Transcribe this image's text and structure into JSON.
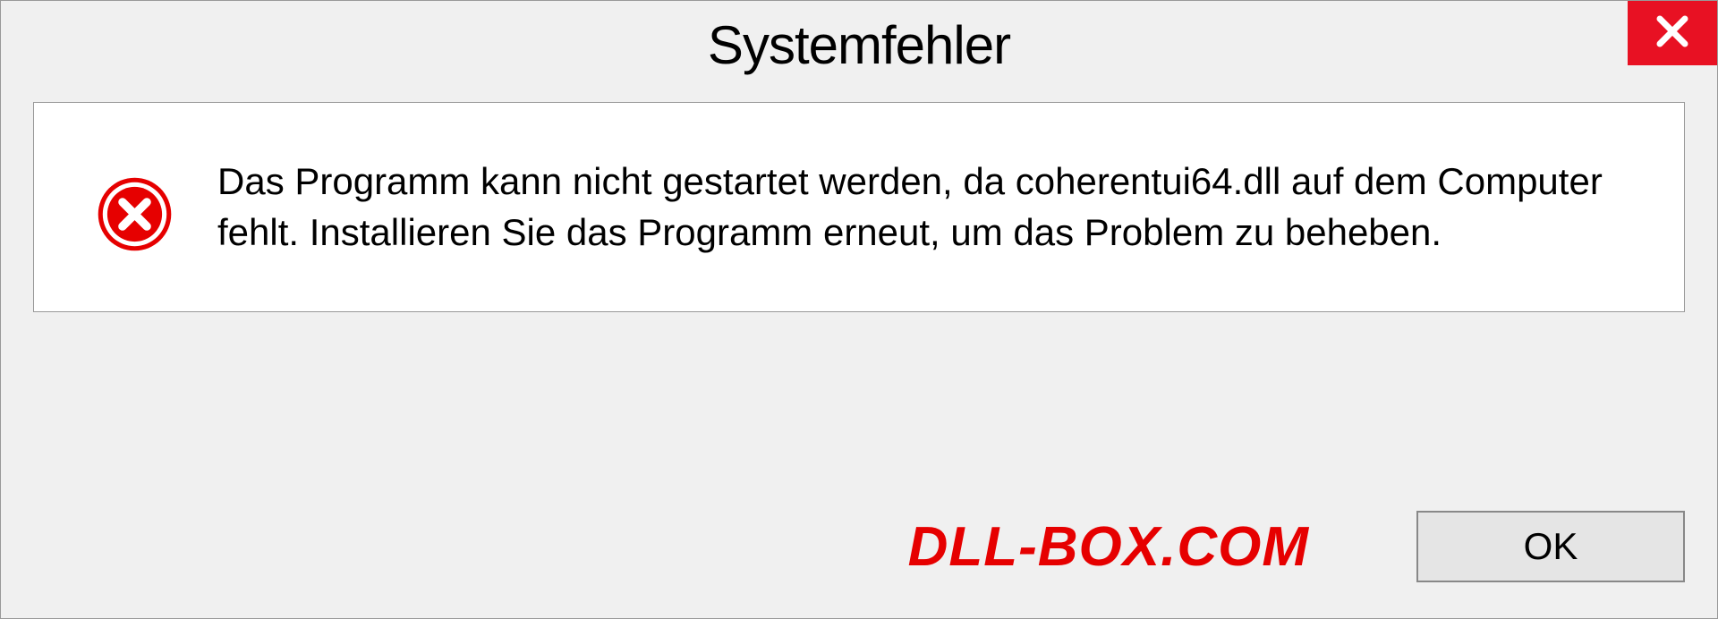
{
  "dialog": {
    "title": "Systemfehler",
    "message": "Das Programm kann nicht gestartet werden, da coherentui64.dll auf dem Computer fehlt. Installieren Sie das Programm erneut, um das Problem zu beheben.",
    "ok_label": "OK"
  },
  "watermark": "DLL-BOX.COM",
  "colors": {
    "close_bg": "#e81123",
    "error_icon": "#e60000",
    "watermark": "#e60000"
  }
}
